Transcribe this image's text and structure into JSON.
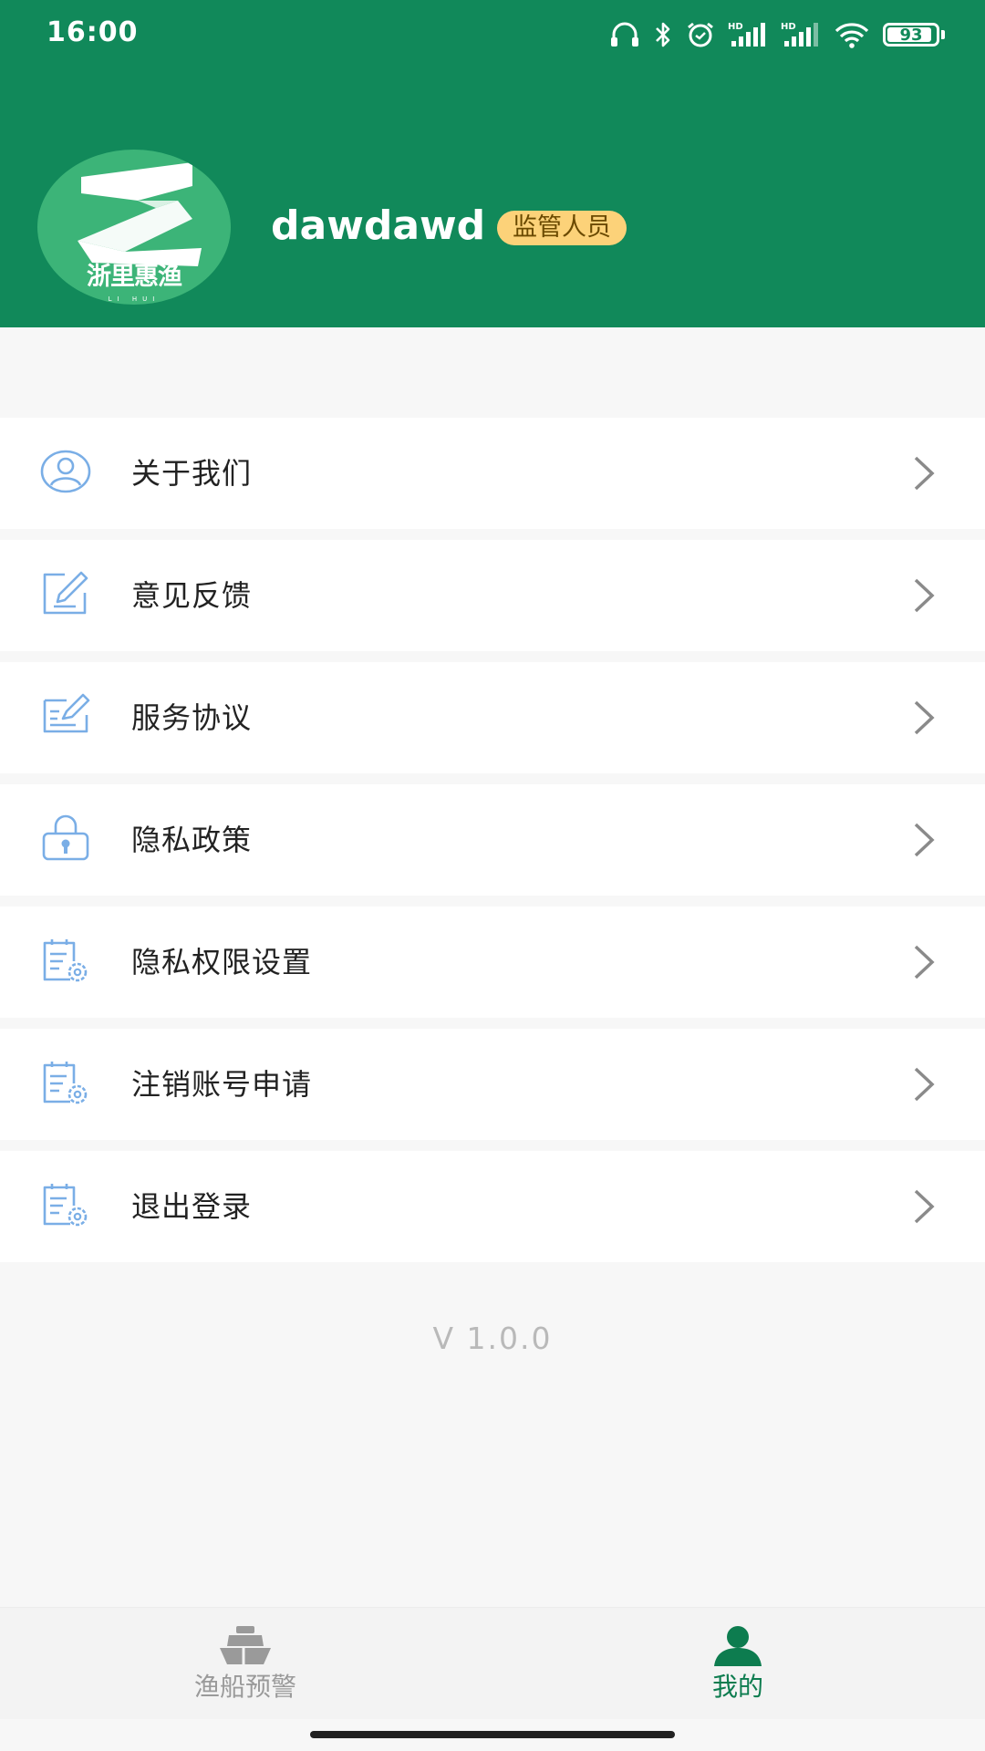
{
  "colors": {
    "brand_green": "#11895a",
    "avatar_green": "#3cb478",
    "badge_yellow": "#fcd279",
    "icon_blue": "#7aaee6",
    "active_tab": "#0d7c4f",
    "inactive_tab": "#9a9a9a",
    "page_bg": "#f7f7f7"
  },
  "status_bar": {
    "time": "16:00",
    "battery": "93",
    "icons": [
      "headset-icon",
      "bluetooth-icon",
      "alarm-icon",
      "hd-signal-icon",
      "hd-signal-icon",
      "wifi-icon",
      "battery-icon"
    ]
  },
  "profile": {
    "avatar_logo_text": "浙里惠渔",
    "avatar_logo_sub": "LI HUI",
    "username": "dawdawd",
    "role": "监管人员"
  },
  "menu": {
    "items": [
      {
        "label": "关于我们",
        "icon": "user-circle-icon"
      },
      {
        "label": "意见反馈",
        "icon": "edit-icon"
      },
      {
        "label": "服务协议",
        "icon": "contract-sign-icon"
      },
      {
        "label": "隐私政策",
        "icon": "lock-icon"
      },
      {
        "label": "隐私权限设置",
        "icon": "clipboard-settings-icon"
      },
      {
        "label": "注销账号申请",
        "icon": "clipboard-settings-icon"
      },
      {
        "label": "退出登录",
        "icon": "clipboard-settings-icon"
      }
    ]
  },
  "version": "V 1.0.0",
  "tabbar": {
    "tabs": [
      {
        "label": "渔船预警",
        "icon": "ship-icon",
        "active": false
      },
      {
        "label": "我的",
        "icon": "person-icon",
        "active": true
      }
    ]
  }
}
